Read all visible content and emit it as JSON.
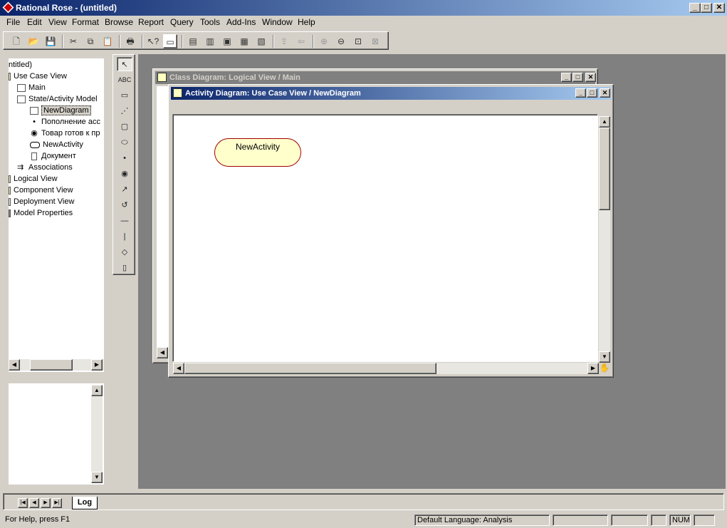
{
  "window": {
    "title": "Rational Rose - (untitled)"
  },
  "menu": [
    "File",
    "Edit",
    "View",
    "Format",
    "Browse",
    "Report",
    "Query",
    "Tools",
    "Add-Ins",
    "Window",
    "Help"
  ],
  "toolbar": {
    "buttons": [
      "new-icon",
      "open-icon",
      "save-icon",
      "cut-icon",
      "copy-icon",
      "paste-icon",
      "print-icon",
      "context-help-icon",
      "view-doc-icon",
      "browse-class-icon",
      "browse-interaction-icon",
      "browse-component-icon",
      "browse-deployment-icon",
      "browse-parent-icon",
      "browse-previous-icon",
      "zoom-in-icon",
      "zoom-out-icon",
      "fit-window-icon",
      "undo-fit-icon"
    ]
  },
  "tree": {
    "items": [
      {
        "label": "ntitled)",
        "indent": 0
      },
      {
        "label": "Use Case View",
        "indent": 1
      },
      {
        "label": "Main",
        "indent": 2
      },
      {
        "label": "State/Activity Model",
        "indent": 2
      },
      {
        "label": "NewDiagram",
        "indent": 3,
        "selected": true
      },
      {
        "label": "Пополнение асс",
        "indent": 3
      },
      {
        "label": "Товар готов к пр",
        "indent": 3
      },
      {
        "label": "NewActivity",
        "indent": 3
      },
      {
        "label": "Документ",
        "indent": 3
      },
      {
        "label": "Associations",
        "indent": 2
      },
      {
        "label": "Logical View",
        "indent": 1
      },
      {
        "label": "Component View",
        "indent": 1
      },
      {
        "label": "Deployment View",
        "indent": 1
      },
      {
        "label": "Model Properties",
        "indent": 1
      }
    ]
  },
  "toolbox": {
    "tools": [
      "selection-arrow-icon",
      "text-box-icon",
      "note-icon",
      "anchor-note-icon",
      "state-icon",
      "activity-icon",
      "start-state-icon",
      "end-state-icon",
      "state-transition-icon",
      "transition-to-self-icon",
      "horizontal-sync-icon",
      "vertical-sync-icon",
      "decision-icon",
      "swimlane-icon"
    ],
    "text_tool": "ABC"
  },
  "windows": {
    "class_diagram": {
      "title": "Class Diagram: Logical View / Main"
    },
    "activity_diagram": {
      "title": "Activity Diagram: Use Case View / NewDiagram"
    }
  },
  "diagram": {
    "activity_label": "NewActivity"
  },
  "log": {
    "tab_label": "Log"
  },
  "status": {
    "help": "For Help, press F1",
    "language": "Default Language: Analysis",
    "num": "NUM"
  }
}
